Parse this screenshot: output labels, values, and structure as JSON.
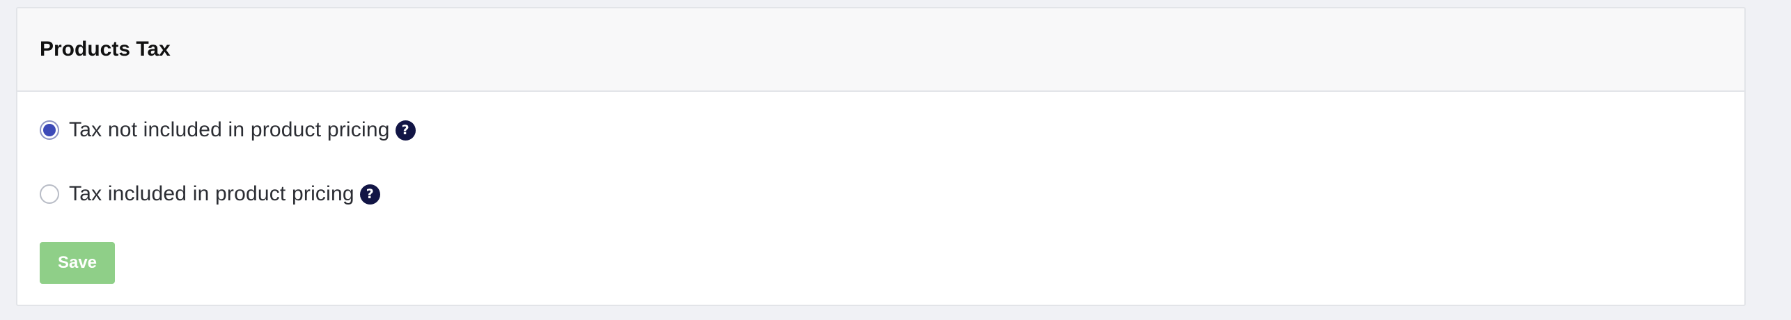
{
  "card": {
    "title": "Products Tax"
  },
  "tax_options": [
    {
      "label": "Tax not included in product pricing",
      "selected": true,
      "help_icon": "question-circle-icon"
    },
    {
      "label": "Tax included in product pricing",
      "selected": false,
      "help_icon": "question-circle-icon"
    }
  ],
  "help_glyph": "?",
  "actions": {
    "save_label": "Save"
  },
  "colors": {
    "accent_radio": "#3d4ab8",
    "help_icon_bg": "#121545",
    "save_button_bg": "#8fcf88"
  }
}
